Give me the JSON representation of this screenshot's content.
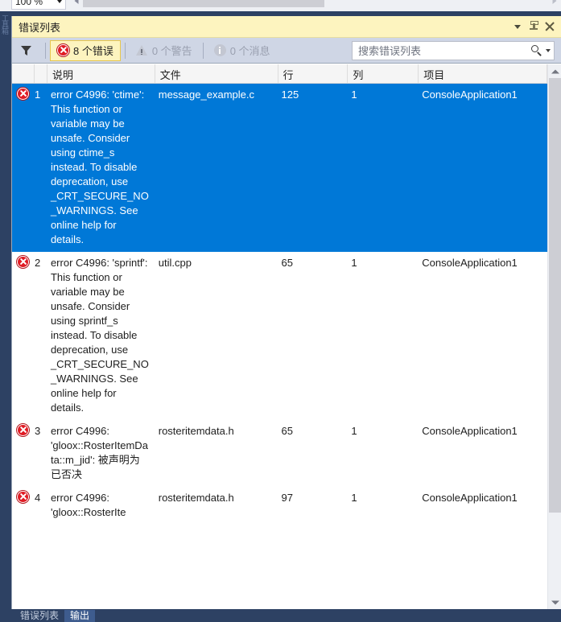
{
  "editor_strip": {
    "zoom_value": "100 %",
    "zoom_caret_icon": "chevron-down-icon",
    "hscroll_left_icon": "arrow-left-icon",
    "hscroll_right_icon": "arrow-right-icon"
  },
  "left_dock": {
    "vertical_tab_label": "工具箱"
  },
  "panel": {
    "title": "错误列表",
    "title_dropdown_icon": "chevron-down-icon",
    "pin_icon": "pin-icon",
    "close_icon": "close-icon"
  },
  "toolbar": {
    "filter_icon": "funnel-icon",
    "filter_caret_icon": "chevron-down-icon",
    "errors": {
      "label": "8 个错误",
      "icon": "error-icon",
      "active": true
    },
    "warnings": {
      "label": "0 个警告",
      "icon": "warning-icon",
      "active": false
    },
    "messages": {
      "label": "0 个消息",
      "icon": "info-icon",
      "active": false
    },
    "search": {
      "placeholder": "搜索错误列表",
      "value": "",
      "search_icon": "search-icon",
      "caret_icon": "chevron-down-icon"
    }
  },
  "grid": {
    "columns": [
      "",
      "",
      "说明",
      "文件",
      "行",
      "列",
      "项目"
    ],
    "rows": [
      {
        "icon": "error-icon",
        "number": "1",
        "description": "error C4996: 'ctime': This function or variable may be unsafe. Consider using ctime_s instead. To disable deprecation, use _CRT_SECURE_NO_WARNINGS. See online help for details.",
        "file": "message_example.c",
        "line": "125",
        "column": "1",
        "project": "ConsoleApplication1",
        "selected": true
      },
      {
        "icon": "error-icon",
        "number": "2",
        "description": "error C4996: 'sprintf': This function or variable may be unsafe. Consider using sprintf_s instead. To disable deprecation, use _CRT_SECURE_NO_WARNINGS. See online help for details.",
        "file": "util.cpp",
        "line": "65",
        "column": "1",
        "project": "ConsoleApplication1",
        "selected": false
      },
      {
        "icon": "error-icon",
        "number": "3",
        "description": "error C4996: 'gloox::RosterItemData::m_jid': 被声明为已否决",
        "file": "rosteritemdata.h",
        "line": "65",
        "column": "1",
        "project": "ConsoleApplication1",
        "selected": false
      },
      {
        "icon": "error-icon",
        "number": "4",
        "description": "error C4996: 'gloox::RosterIte",
        "file": "rosteritemdata.h",
        "line": "97",
        "column": "1",
        "project": "ConsoleApplication1",
        "selected": false
      }
    ]
  },
  "scrollbar": {
    "up_icon": "arrow-up-icon",
    "down_icon": "arrow-down-icon"
  },
  "bottom_tabs": [
    {
      "label": "错误列表",
      "active": false
    },
    {
      "label": "输出",
      "active": true
    }
  ],
  "colors": {
    "selection": "#0078d7",
    "title_bar": "#fdf4bf",
    "toolbar": "#cfd6e5",
    "error_red": "#e01b24",
    "chrome_blue": "#2d4163"
  }
}
